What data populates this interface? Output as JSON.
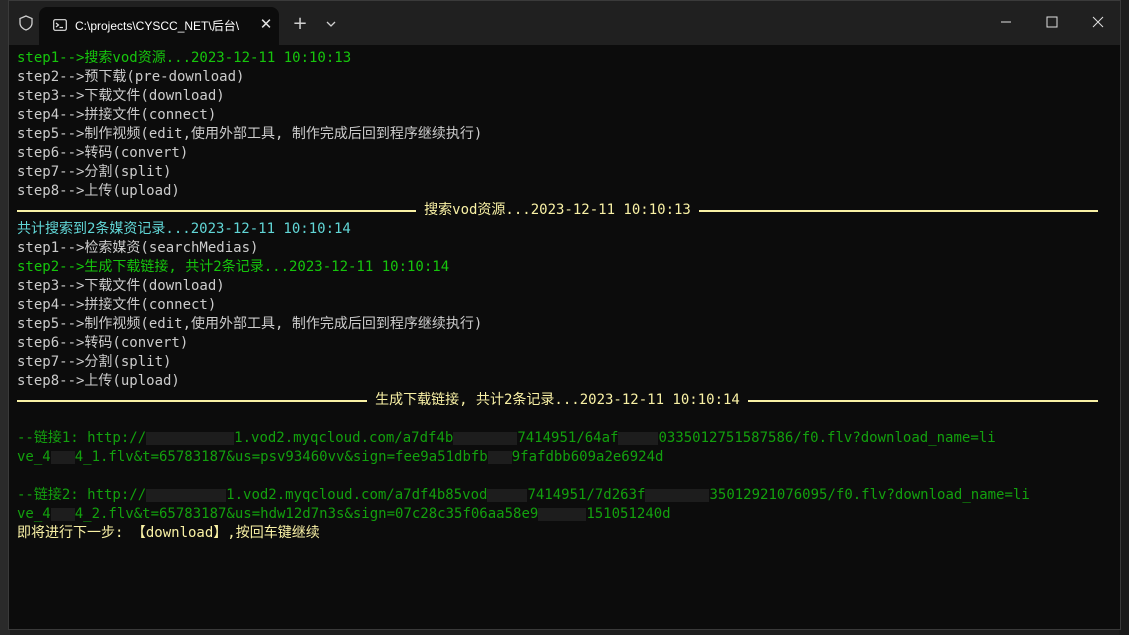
{
  "window": {
    "tab_title": "C:\\projects\\CYSCC_NET\\后台\\",
    "shield_icon": "shield-icon",
    "tab_icon": "terminal-icon",
    "close_tab_glyph": "✕",
    "new_tab_glyph": "+",
    "controls": [
      "minimize-icon",
      "maximize-icon",
      "close-icon"
    ]
  },
  "colors": {
    "green": "#16c60c",
    "cyan": "#61d6d6",
    "yellow": "#f9f1a5",
    "default": "#cccccc",
    "link": "#13a10e"
  },
  "terminal": {
    "block1": [
      "step1-->搜索vod资源...2023-12-11 10:10:13",
      "step2-->预下载(pre-download)",
      "step3-->下载文件(download)",
      "step4-->拼接文件(connect)",
      "step5-->制作视频(edit,使用外部工具, 制作完成后回到程序继续执行)",
      "step6-->转码(convert)",
      "step7-->分割(split)",
      "step8-->上传(upload)"
    ],
    "divider1": "搜索vod资源...2023-12-11 10:10:13",
    "summary": "共计搜索到2条媒资记录...2023-12-11 10:10:14",
    "block2": [
      "step1-->检索媒资(searchMedias)",
      "step2-->生成下载链接, 共计2条记录...2023-12-11 10:10:14",
      "step3-->下载文件(download)",
      "step4-->拼接文件(connect)",
      "step5-->制作视频(edit,使用外部工具, 制作完成后回到程序继续执行)",
      "step6-->转码(convert)",
      "step7-->分割(split)",
      "step8-->上传(upload)"
    ],
    "divider2": "生成下载链接, 共计2条记录...2023-12-11 10:10:14",
    "link1": {
      "prefix": "--链接1: http://",
      "part_a": "1.vod2.myqcloud.com/a7df4b",
      "part_b": "7414951/64af",
      "part_c": "0335012751587586/f0.flv?download_name=li",
      "line2_a": "ve_4",
      "line2_b": "4_1.flv&t=65783187&us=psv93460vv&sign=fee9a51dbfb",
      "line2_c": "9fafdbb609a2e6924d"
    },
    "link2": {
      "prefix": "--链接2: http://",
      "part_a": "1.vod2.myqcloud.com/a7df4b85vod",
      "part_b": "7414951/7d263f",
      "part_c": "35012921076095/f0.flv?download_name=li",
      "line2_a": "ve_4",
      "line2_b": "4_2.flv&t=65783187&us=hdw12d7n3s&sign=07c28c35f06aa58e9",
      "line2_c": "151051240d"
    },
    "prompt": "即将进行下一步: 【download】,按回车键继续"
  }
}
